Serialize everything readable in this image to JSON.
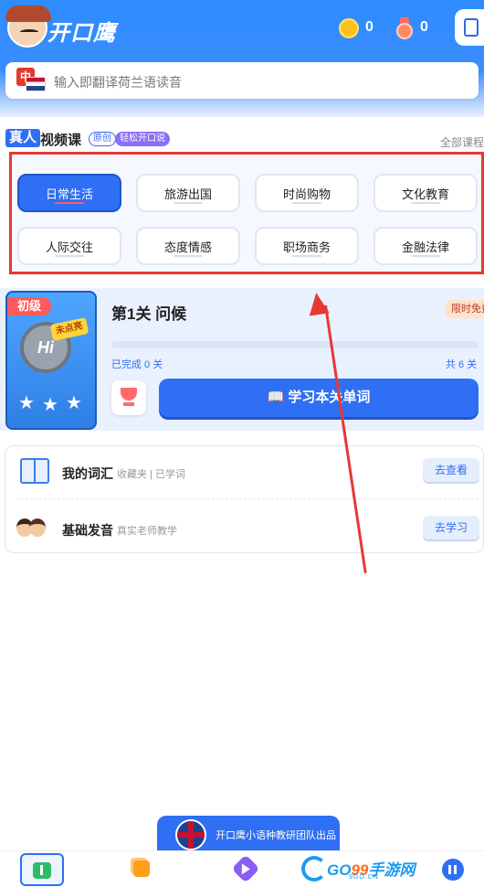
{
  "header": {
    "app_title": "开口鹰",
    "coins": "0",
    "medals": "0"
  },
  "search": {
    "flag_label": "中",
    "placeholder": "输入即翻译荷兰语读音"
  },
  "course_section": {
    "tag": "真人",
    "title": "视频课",
    "badge_original": "原创",
    "badge_easy": "轻松开口说",
    "all_courses": "全部课程",
    "categories": [
      {
        "label": "日常生活",
        "active": true
      },
      {
        "label": "旅游出国",
        "active": false
      },
      {
        "label": "时尚购物",
        "active": false
      },
      {
        "label": "文化教育",
        "active": false
      },
      {
        "label": "人际交往",
        "active": false
      },
      {
        "label": "态度情感",
        "active": false
      },
      {
        "label": "职场商务",
        "active": false
      },
      {
        "label": "金融法律",
        "active": false
      }
    ]
  },
  "lesson": {
    "level": "初级",
    "badge_status": "未点亮",
    "badge_text": "Hi",
    "stars": 3,
    "title": "第1关 问候",
    "limited_tag": "限时免费",
    "completed": "已完成 0 关",
    "total": "共 6 关",
    "progress": 0,
    "study_button": "📖 学习本关单词"
  },
  "vocab": {
    "words_title": "我的词汇",
    "words_sub": "收藏夹 | 已学词",
    "words_button": "去查看",
    "pron_title": "基础发音",
    "pron_sub": "真实老师教学",
    "pron_button": "去学习"
  },
  "footer": {
    "promo_text": "开口鹰小语种教研团队出品",
    "watermark_prefix": "GO",
    "watermark_num": "99",
    "watermark_suffix": "手游网",
    "watermark_url": "9GO.CN"
  },
  "colors": {
    "primary": "#2f6ff3",
    "highlight_box": "#e53935",
    "card_bg": "#e9f1ff"
  }
}
